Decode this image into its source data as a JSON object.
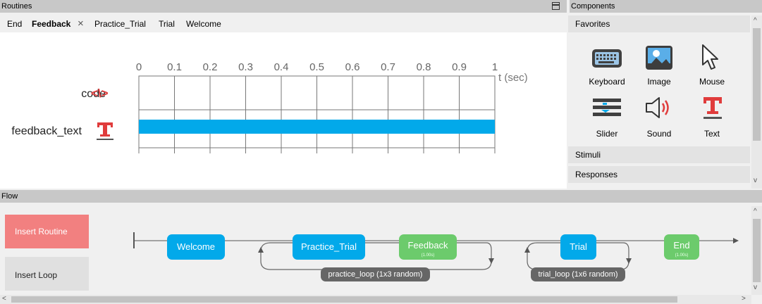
{
  "routines_panel": {
    "title": "Routines"
  },
  "components_panel": {
    "title": "Components",
    "categories": [
      "Favorites",
      "Stimuli",
      "Responses"
    ],
    "favorites": [
      "Keyboard",
      "Image",
      "Mouse",
      "Slider",
      "Sound",
      "Text"
    ]
  },
  "flow_panel": {
    "title": "Flow"
  },
  "tabs": [
    {
      "label": "End"
    },
    {
      "label": "Feedback",
      "active": true
    },
    {
      "label": "Practice_Trial"
    },
    {
      "label": "Trial"
    },
    {
      "label": "Welcome"
    }
  ],
  "timeline": {
    "unit_label": "t (sec)",
    "ticks": [
      "0",
      "0.1",
      "0.2",
      "0.3",
      "0.4",
      "0.5",
      "0.6",
      "0.7",
      "0.8",
      "0.9",
      "1"
    ],
    "components": [
      {
        "name": "code",
        "icon": "code-icon",
        "start": null,
        "stop": null
      },
      {
        "name": "feedback_text",
        "icon": "text-icon",
        "start": 0,
        "stop": 1
      }
    ],
    "bar_color": "#02a9ea"
  },
  "flow": {
    "insert_routine": "Insert Routine",
    "insert_loop": "Insert Loop",
    "routines": [
      {
        "name": "Welcome",
        "color": "blue"
      },
      {
        "name": "Practice_Trial",
        "color": "blue"
      },
      {
        "name": "Feedback",
        "color": "green",
        "duration": "(1.00s)"
      },
      {
        "name": "Trial",
        "color": "blue"
      },
      {
        "name": "End",
        "color": "green",
        "duration": "(1.00s)"
      }
    ],
    "loops": [
      {
        "label": "practice_loop  (1x3 random)"
      },
      {
        "label": "trial_loop  (1x6 random)"
      }
    ]
  },
  "colors": {
    "routine_blue": "#02a9ea",
    "routine_green": "#6ccb6c",
    "insert_routine": "#f28080",
    "icon_red": "#e03c3c"
  }
}
